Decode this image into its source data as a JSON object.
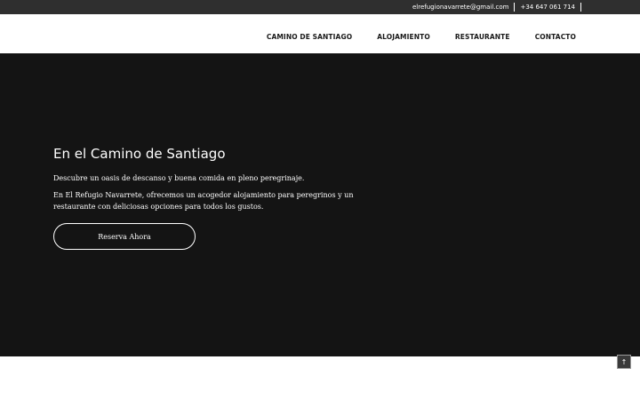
{
  "topbar": {
    "email": "elrefugionavarrete@gmail.com",
    "phone": "+34 647 061 714"
  },
  "nav": {
    "items": [
      {
        "label": "CAMINO DE SANTIAGO"
      },
      {
        "label": "ALOJAMIENTO"
      },
      {
        "label": "RESTAURANTE"
      },
      {
        "label": "CONTACTO"
      }
    ]
  },
  "hero": {
    "title": "En el Camino de Santiago",
    "paragraph1": "Descubre un oasis de descanso y buena comida en pleno peregrinaje.",
    "paragraph2": "En El Refugio Navarrete, ofrecemos un acogedor alojamiento para peregrinos y un restaurante con deliciosas opciones para todos los gustos.",
    "cta_label": "Reserva Ahora"
  },
  "colors": {
    "hero_bg": "#141414",
    "topbar_bg": "#2f2f2f",
    "header_bg": "#ffffff"
  },
  "icons": {
    "scroll_top": "arrow-up-icon"
  }
}
